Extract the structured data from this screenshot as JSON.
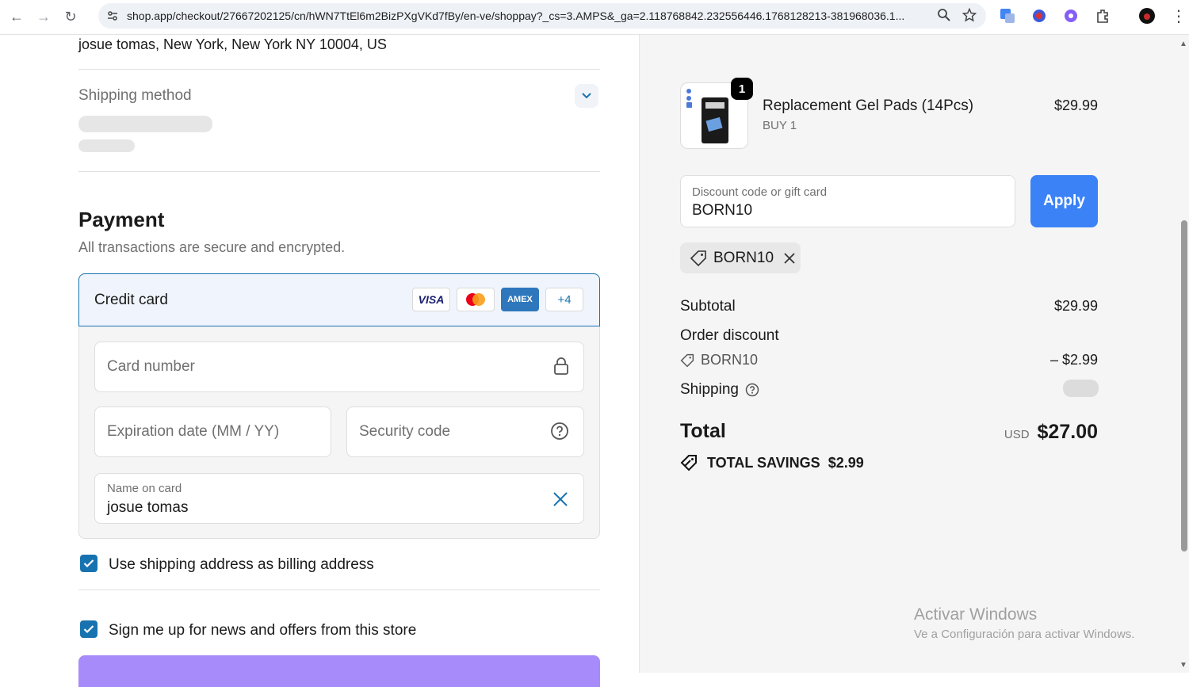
{
  "browser": {
    "url": "shop.app/checkout/27667202125/cn/hWN7TtEl6m2BizPXgVKd7fBy/en-ve/shoppay?_cs=3.AMPS&_ga=2.118768842.232556446.1768128213-381968036.1..."
  },
  "shipping": {
    "address": "josue tomas, New York, New York NY 10004, US",
    "method_label": "Shipping method"
  },
  "payment": {
    "title": "Payment",
    "subtitle": "All transactions are secure and encrypted.",
    "method_label": "Credit card",
    "cards": [
      "VISA",
      "Mastercard",
      "AMEX",
      "+4"
    ],
    "card_number_placeholder": "Card number",
    "expiration_placeholder": "Expiration date (MM / YY)",
    "security_placeholder": "Security code",
    "name_label": "Name on card",
    "name_value": "josue tomas",
    "billing_checkbox_label": "Use shipping address as billing address",
    "news_checkbox_label": "Sign me up for news and offers from this store"
  },
  "order": {
    "product_name": "Replacement Gel Pads (14Pcs)",
    "product_sub": "BUY 1",
    "product_price": "$29.99",
    "quantity": "1",
    "discount_label": "Discount code or gift card",
    "discount_value": "BORN10",
    "apply_label": "Apply",
    "applied_code": "BORN10",
    "subtotal_label": "Subtotal",
    "subtotal_value": "$29.99",
    "order_discount_label": "Order discount",
    "discount_code_row": "BORN10",
    "discount_amount": "– $2.99",
    "shipping_label": "Shipping",
    "total_label": "Total",
    "currency": "USD",
    "total_value": "$27.00",
    "savings_label": "TOTAL SAVINGS",
    "savings_value": "$2.99"
  },
  "watermark": {
    "title": "Activar Windows",
    "subtitle": "Ve a Configuración para activar Windows."
  },
  "colors": {
    "accent": "#1773b0",
    "apply_button": "#3b82f6",
    "pay_button": "#a78bfa"
  }
}
